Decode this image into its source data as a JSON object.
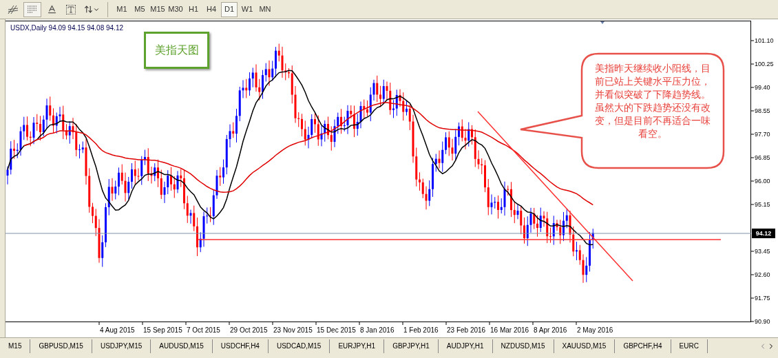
{
  "toolbar": {
    "periods": [
      {
        "label": "M1",
        "selected": false
      },
      {
        "label": "M5",
        "selected": false
      },
      {
        "label": "M15",
        "selected": false
      },
      {
        "label": "M30",
        "selected": false
      },
      {
        "label": "H1",
        "selected": false
      },
      {
        "label": "H4",
        "selected": false
      },
      {
        "label": "D1",
        "selected": true
      },
      {
        "label": "W1",
        "selected": false
      },
      {
        "label": "MN",
        "selected": false
      }
    ]
  },
  "chart": {
    "symbol_line": "USDX,Daily  94.09 94.15 94.08 94.12",
    "title_box": "美指天图",
    "callout": "美指昨天继续收小阳线，目前已站上关键水平压力位，并看似突破了下降趋势线。虽然大的下跌趋势还没有改变，但是目前不再适合一味看空。",
    "price_axis": [
      "101.10",
      "100.25",
      "99.40",
      "98.55",
      "97.70",
      "96.85",
      "96.00",
      "95.15",
      "93.45",
      "92.60",
      "91.75",
      "90.90"
    ],
    "current_price": "94.12",
    "date_axis": [
      "4 Aug 2015",
      "15 Sep 2015",
      "7 Oct 2015",
      "29 Oct 2015",
      "23 Nov 2015",
      "15 Dec 2015",
      "8 Jan 2016",
      "1 Feb 2016",
      "23 Feb 2016",
      "16 Mar 2016",
      "8 Apr 2016",
      "2 May 2016"
    ]
  },
  "symbol_tabs": [
    {
      "label": "M15",
      "selected": false
    },
    {
      "label": "GBPUSD,M15",
      "selected": false
    },
    {
      "label": "USDJPY,M15",
      "selected": false
    },
    {
      "label": "AUDUSD,M15",
      "selected": false
    },
    {
      "label": "USDCHF,H4",
      "selected": false
    },
    {
      "label": "USDCAD,M15",
      "selected": false
    },
    {
      "label": "EURJPY,H1",
      "selected": false
    },
    {
      "label": "GBPJPY,H1",
      "selected": false
    },
    {
      "label": "AUDJPY,H1",
      "selected": false
    },
    {
      "label": "NZDUSD,M15",
      "selected": false
    },
    {
      "label": "XAUUSD,M15",
      "selected": false
    },
    {
      "label": "GBPCHF,H4",
      "selected": false
    },
    {
      "label": "EURC",
      "selected": false
    }
  ]
}
